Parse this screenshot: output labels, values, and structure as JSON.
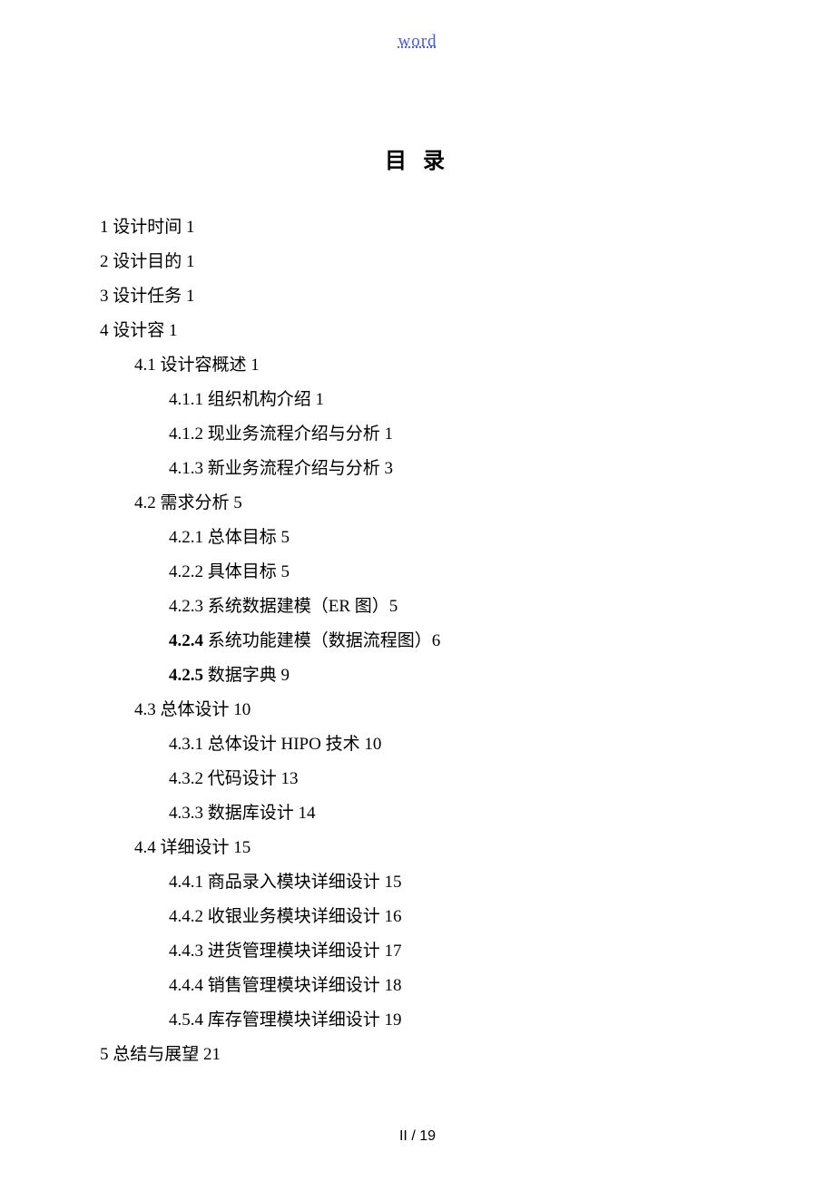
{
  "header": {
    "link_text": "word"
  },
  "title": "目 录",
  "toc": [
    {
      "level": 1,
      "num": "1",
      "text": " 设计时间 1",
      "bold": false
    },
    {
      "level": 1,
      "num": "2",
      "text": " 设计目的 1",
      "bold": false
    },
    {
      "level": 1,
      "num": "3",
      "text": " 设计任务 1",
      "bold": false
    },
    {
      "level": 1,
      "num": "4",
      "text": " 设计容 1",
      "bold": false
    },
    {
      "level": 2,
      "num": "4.1",
      "text": " 设计容概述 1",
      "bold": false
    },
    {
      "level": 3,
      "num": "4.1.1",
      "text": " 组织机构介绍 1",
      "bold": false
    },
    {
      "level": 3,
      "num": "4.1.2",
      "text": " 现业务流程介绍与分析 1",
      "bold": false
    },
    {
      "level": 3,
      "num": "4.1.3",
      "text": " 新业务流程介绍与分析 3",
      "bold": false
    },
    {
      "level": 2,
      "num": "4.2",
      "text": " 需求分析 5",
      "bold": false
    },
    {
      "level": 3,
      "num": "4.2.1",
      "text": " 总体目标 5",
      "bold": false
    },
    {
      "level": 3,
      "num": "4.2.2",
      "text": " 具体目标 5",
      "bold": false
    },
    {
      "level": 3,
      "num": "4.2.3",
      "text": " 系统数据建模（ER 图）5",
      "bold": false
    },
    {
      "level": 3,
      "num": "4.2.4",
      "text": " 系统功能建模（数据流程图）6",
      "bold": true
    },
    {
      "level": 3,
      "num": "4.2.5",
      "text": " 数据字典 9",
      "bold": true
    },
    {
      "level": 2,
      "num": "4.3",
      "text": " 总体设计 10",
      "bold": false
    },
    {
      "level": 3,
      "num": "4.3.1",
      "text": " 总体设计 HIPO 技术 10",
      "bold": false
    },
    {
      "level": 3,
      "num": "4.3.2",
      "text": " 代码设计 13",
      "bold": false
    },
    {
      "level": 3,
      "num": "4.3.3",
      "text": " 数据库设计 14",
      "bold": false
    },
    {
      "level": 2,
      "num": "4.4",
      "text": " 详细设计 15",
      "bold": false
    },
    {
      "level": 3,
      "num": "4.4.1",
      "text": " 商品录入模块详细设计 15",
      "bold": false
    },
    {
      "level": 3,
      "num": "4.4.2",
      "text": " 收银业务模块详细设计 16",
      "bold": false
    },
    {
      "level": 3,
      "num": "4.4.3",
      "text": " 进货管理模块详细设计 17",
      "bold": false
    },
    {
      "level": 3,
      "num": "4.4.4",
      "text": " 销售管理模块详细设计 18",
      "bold": false
    },
    {
      "level": 3,
      "num": "4.5.4",
      "text": " 库存管理模块详细设计 19",
      "bold": false
    },
    {
      "level": 1,
      "num": "5",
      "text": " 总结与展望 21",
      "bold": false
    }
  ],
  "footer": {
    "page": "II / 19"
  }
}
